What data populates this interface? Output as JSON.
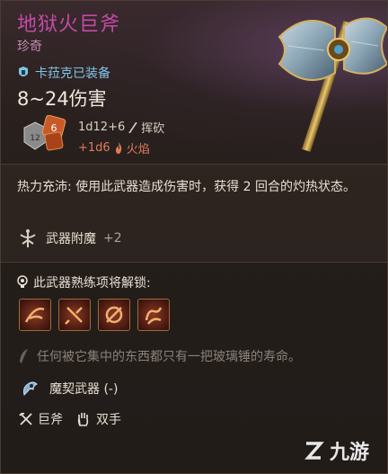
{
  "item": {
    "name": "地狱火巨斧",
    "rarity": "珍奇",
    "equipped_text": "卡菈克已装备",
    "damage": "8~24伤害",
    "dice_value_orange": "6",
    "dice_value_grey": "12",
    "roll_main": "1d12+6",
    "roll_main_type": "挥砍",
    "roll_bonus": "+1d6",
    "roll_bonus_type": "火焰",
    "heat_text": "热力充沛: 使用此武器造成伤害时，获得 2 回合的灼热状态。",
    "enchant_label": "武器附魔",
    "enchant_value": "+2",
    "proficiency_title": "此武器熟练项将解锁:",
    "flavor": "任何被它集中的东西都只有一把玻璃锤的寿命。",
    "pact_label": "魔契武器 (-)",
    "tag_axe": "巨斧",
    "tag_hands": "双手"
  },
  "watermark": {
    "text": "九游"
  },
  "colors": {
    "title": "#c44aa8",
    "rarity": "#c48ab8",
    "equipped": "#7fc4e6",
    "fire": "#e07a5a"
  },
  "icons": {
    "equipped": "armor-icon",
    "slash": "slash-icon",
    "fire": "flame-icon",
    "enchant": "enchant-icon",
    "proficiency": "bulb-icon",
    "flavor": "quill-icon",
    "pact": "pact-icon",
    "axe": "crossed-axes-icon",
    "hands": "hand-icon",
    "skills": [
      "cleave-skill-icon",
      "lacerate-skill-icon",
      "topple-skill-icon",
      "prepare-skill-icon"
    ]
  }
}
